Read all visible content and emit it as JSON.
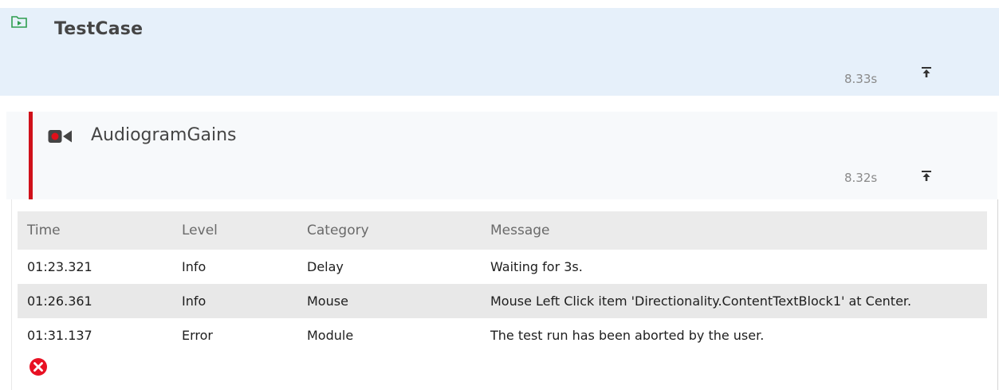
{
  "testcase": {
    "title": "TestCase",
    "duration": "8.33s",
    "icon": "folder-play-icon",
    "collapse_icon": "collapse-up-icon"
  },
  "module": {
    "title": "AudiogramGains",
    "duration": "8.32s",
    "icon": "record-camera-icon",
    "status_color": "#d0101a",
    "collapse_icon": "collapse-up-icon"
  },
  "log": {
    "columns": [
      "Time",
      "Level",
      "Category",
      "Message"
    ],
    "rows": [
      {
        "time": "01:23.321",
        "level": "Info",
        "category": "Delay",
        "message": "Waiting for 3s."
      },
      {
        "time": "01:26.361",
        "level": "Info",
        "category": "Mouse",
        "message": "Mouse Left Click item 'Directionality.ContentTextBlock1' at Center."
      },
      {
        "time": "01:31.137",
        "level": "Error",
        "category": "Module",
        "message": "The test run has been aborted by the user."
      }
    ],
    "error_icon": "error-x-icon"
  }
}
